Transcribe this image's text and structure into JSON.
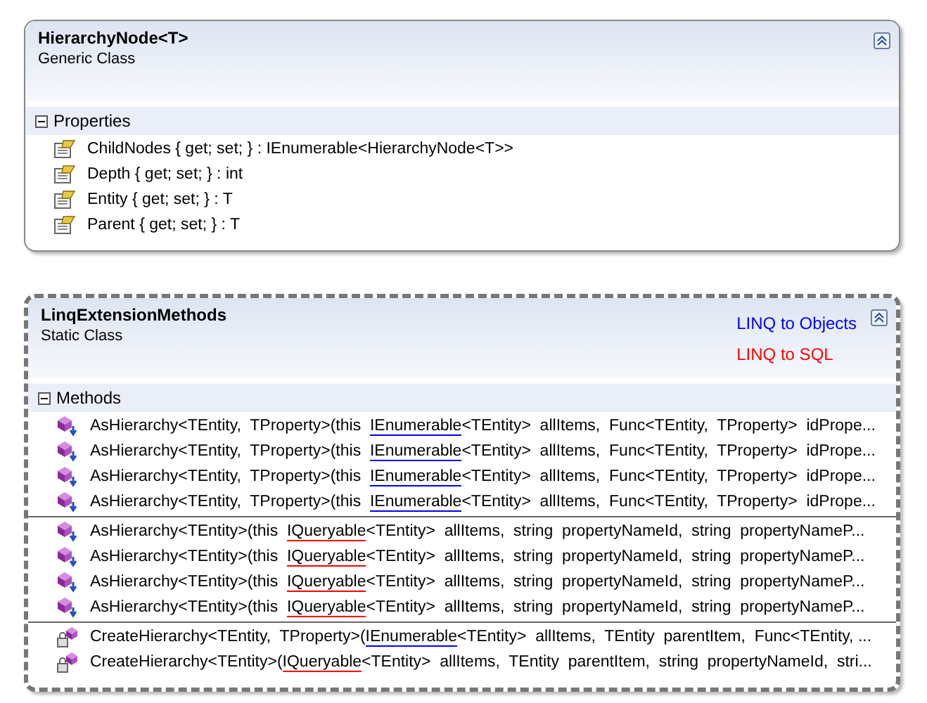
{
  "classes": [
    {
      "name": "HierarchyNode<T>",
      "stereotype": "Generic Class",
      "dashed": false,
      "compartments": [
        {
          "title": "Properties",
          "expanded": true,
          "groups": [
            [
              {
                "kind": "property",
                "prefix": "ChildNodes { get; set; } : IEnumerable<HierarchyNode<T>>"
              },
              {
                "kind": "property",
                "prefix": "Depth { get; set; } : int"
              },
              {
                "kind": "property",
                "prefix": "Entity { get; set; } : T"
              },
              {
                "kind": "property",
                "prefix": "Parent { get; set; } : T"
              }
            ]
          ]
        }
      ]
    },
    {
      "name": "LinqExtensionMethods",
      "stereotype": "Static Class",
      "dashed": true,
      "legend": [
        {
          "text": "LINQ to Objects",
          "color": "#0000ff"
        },
        {
          "text": "LINQ to SQL",
          "color": "#ff0000"
        }
      ],
      "compartments": [
        {
          "title": "Methods",
          "expanded": true,
          "groups": [
            [
              {
                "kind": "extension",
                "prefix": "AsHierarchy<TEntity,  TProperty>(this  ",
                "link": "IEnumerable",
                "color": "#0000ff",
                "suffix": "<TEntity>  allItems,  Func<TEntity,  TProperty>  idPrope..."
              },
              {
                "kind": "extension",
                "prefix": "AsHierarchy<TEntity,  TProperty>(this  ",
                "link": "IEnumerable",
                "color": "#0000ff",
                "suffix": "<TEntity>  allItems,  Func<TEntity,  TProperty>  idPrope..."
              },
              {
                "kind": "extension",
                "prefix": "AsHierarchy<TEntity,  TProperty>(this  ",
                "link": "IEnumerable",
                "color": "#0000ff",
                "suffix": "<TEntity>  allItems,  Func<TEntity,  TProperty>  idPrope..."
              },
              {
                "kind": "extension",
                "prefix": "AsHierarchy<TEntity,  TProperty>(this  ",
                "link": "IEnumerable",
                "color": "#0000ff",
                "suffix": "<TEntity>  allItems,  Func<TEntity,  TProperty>  idPrope..."
              }
            ],
            [
              {
                "kind": "extension",
                "prefix": "AsHierarchy<TEntity>(this  ",
                "link": "IQueryable",
                "color": "#ff0000",
                "suffix": "<TEntity>  allItems,  string  propertyNameId,  string  propertyNameP..."
              },
              {
                "kind": "extension",
                "prefix": "AsHierarchy<TEntity>(this  ",
                "link": "IQueryable",
                "color": "#ff0000",
                "suffix": "<TEntity>  allItems,  string  propertyNameId,  string  propertyNameP..."
              },
              {
                "kind": "extension",
                "prefix": "AsHierarchy<TEntity>(this  ",
                "link": "IQueryable",
                "color": "#ff0000",
                "suffix": "<TEntity>  allItems,  string  propertyNameId,  string  propertyNameP..."
              },
              {
                "kind": "extension",
                "prefix": "AsHierarchy<TEntity>(this  ",
                "link": "IQueryable",
                "color": "#ff0000",
                "suffix": "<TEntity>  allItems,  string  propertyNameId,  string  propertyNameP..."
              }
            ],
            [
              {
                "kind": "private",
                "prefix": "CreateHierarchy<TEntity,  TProperty>(",
                "link": "IEnumerable",
                "color": "#0000ff",
                "suffix": "<TEntity>  allItems,  TEntity  parentItem,  Func<TEntity, ..."
              },
              {
                "kind": "private",
                "prefix": "CreateHierarchy<TEntity>(",
                "link": "IQueryable",
                "color": "#ff0000",
                "suffix": "<TEntity>  allItems,  TEntity  parentItem,  string  propertyNameId,  stri..."
              }
            ]
          ]
        }
      ]
    }
  ]
}
